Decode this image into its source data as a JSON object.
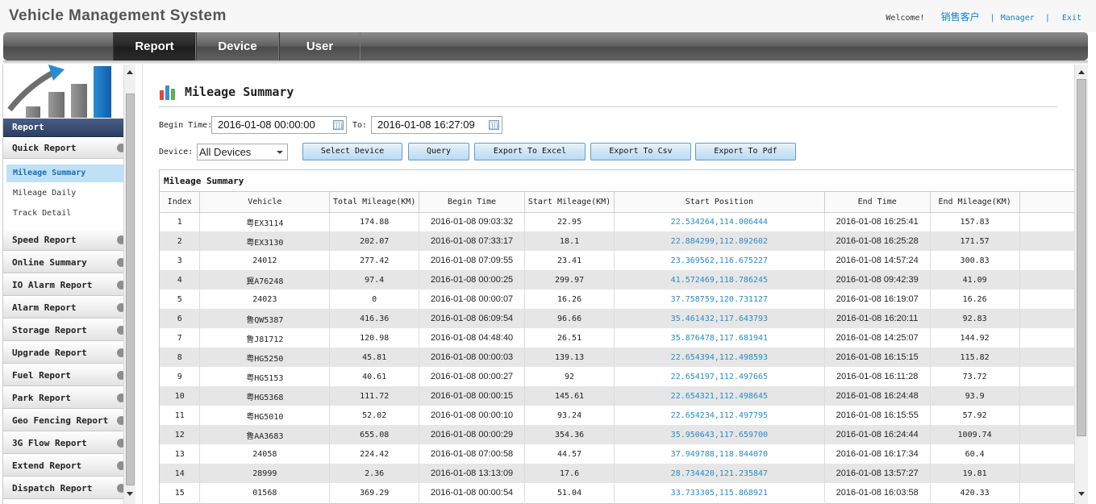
{
  "app": {
    "title": "Vehicle Management System",
    "welcome": "Welcome!",
    "user": "销售客户",
    "manager_link": "Manager",
    "exit_link": "Exit"
  },
  "nav": {
    "tabs": [
      {
        "label": "Report",
        "active": true
      },
      {
        "label": "Device",
        "active": false
      },
      {
        "label": "User",
        "active": false
      }
    ]
  },
  "sidebar": {
    "header": "Report",
    "quick_report": "Quick Report",
    "sub_items": [
      "Mileage Summary",
      "Mileage Daily",
      "Track Detail"
    ],
    "active_sub": "Mileage Summary",
    "menu": [
      "Speed Report",
      "Online Summary",
      "IO Alarm Report",
      "Alarm Report",
      "Storage Report",
      "Upgrade Report",
      "Fuel Report",
      "Park Report",
      "Geo Fencing Report",
      "3G Flow Report",
      "Extend Report",
      "Dispatch Report"
    ]
  },
  "main": {
    "heading": "Mileage Summary",
    "form": {
      "begin_label": "Begin Time:",
      "begin_value": "2016-01-08 00:00:00",
      "to_label": "To:",
      "to_value": "2016-01-08 16:27:09",
      "device_label": "Device:",
      "device_value": "All Devices"
    },
    "buttons": {
      "select_device": "Select Device",
      "query": "Query",
      "export_excel": "Export To Excel",
      "export_csv": "Export To Csv",
      "export_pdf": "Export To Pdf"
    },
    "grid": {
      "title": "Mileage Summary",
      "columns": [
        "Index",
        "Vehicle",
        "Total Mileage(KM)",
        "Begin Time",
        "Start Mileage(KM)",
        "Start Position",
        "End Time",
        "End Mileage(KM)"
      ],
      "rows": [
        [
          "1",
          "粤EX3114",
          "174.88",
          "2016-01-08 09:03:32",
          "22.95",
          "22.534264,114.006444",
          "2016-01-08 16:25:41",
          "157.83"
        ],
        [
          "2",
          "粤EX3130",
          "202.07",
          "2016-01-08 07:33:17",
          "18.1",
          "22.884299,112.892602",
          "2016-01-08 16:25:28",
          "171.57"
        ],
        [
          "3",
          "24012",
          "277.42",
          "2016-01-08 07:09:55",
          "23.41",
          "23.369562,116.675227",
          "2016-01-08 14:57:24",
          "300.83"
        ],
        [
          "4",
          "冀A76248",
          "97.4",
          "2016-01-08 00:00:25",
          "299.97",
          "41.572469,118.786245",
          "2016-01-08 09:42:39",
          "41.09"
        ],
        [
          "5",
          "24023",
          "0",
          "2016-01-08 00:00:07",
          "16.26",
          "37.758759,120.731127",
          "2016-01-08 16:19:07",
          "16.26"
        ],
        [
          "6",
          "鲁QW5387",
          "416.36",
          "2016-01-08 06:09:54",
          "96.66",
          "35.461432,117.643793",
          "2016-01-08 16:20:11",
          "92.83"
        ],
        [
          "7",
          "鲁J81712",
          "120.98",
          "2016-01-08 04:48:40",
          "26.51",
          "35.876478,117.681941",
          "2016-01-08 14:25:07",
          "144.92"
        ],
        [
          "8",
          "粤HG5250",
          "45.81",
          "2016-01-08 00:00:03",
          "139.13",
          "22.654394,112.498593",
          "2016-01-08 16:15:15",
          "115.82"
        ],
        [
          "9",
          "粤HG5153",
          "40.61",
          "2016-01-08 00:00:27",
          "92",
          "22.654197,112.497665",
          "2016-01-08 16:11:28",
          "73.72"
        ],
        [
          "10",
          "粤HG5368",
          "111.72",
          "2016-01-08 00:00:15",
          "145.61",
          "22.654321,112.498645",
          "2016-01-08 16:24:48",
          "93.9"
        ],
        [
          "11",
          "粤HG5010",
          "52.02",
          "2016-01-08 00:00:10",
          "93.24",
          "22.654234,112.497795",
          "2016-01-08 16:15:55",
          "57.92"
        ],
        [
          "12",
          "鲁AA3683",
          "655.08",
          "2016-01-08 00:00:29",
          "354.36",
          "35.950643,117.659700",
          "2016-01-08 16:24:44",
          "1009.74"
        ],
        [
          "13",
          "24058",
          "224.42",
          "2016-01-08 07:00:58",
          "44.57",
          "37.949788,118.844070",
          "2016-01-08 16:17:34",
          "60.4"
        ],
        [
          "14",
          "28999",
          "2.36",
          "2016-01-08 13:13:09",
          "17.6",
          "28.734420,121.235847",
          "2016-01-08 13:57:27",
          "19.81"
        ],
        [
          "15",
          "01568",
          "369.29",
          "2016-01-08 00:00:54",
          "51.04",
          "33.733305,115.868921",
          "2016-01-08 16:03:58",
          "420.33"
        ]
      ]
    }
  }
}
